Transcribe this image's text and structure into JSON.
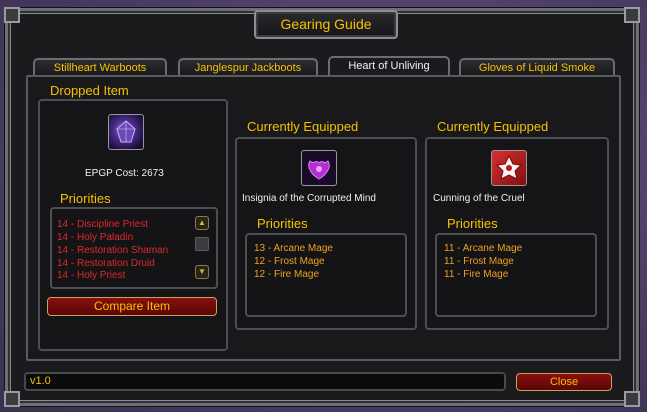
{
  "window": {
    "title": "Gearing Guide"
  },
  "tabs": [
    {
      "label": "Stillheart Warboots"
    },
    {
      "label": "Janglespur Jackboots"
    },
    {
      "label": "Heart of Unliving"
    },
    {
      "label": "Gloves of Liquid Smoke"
    }
  ],
  "dropped": {
    "heading": "Dropped Item",
    "icon": "dark-purple-gem-icon",
    "cost": "EPGP Cost: 2673",
    "priorities_heading": "Priorities",
    "priorities": [
      "14 - Discipline Priest",
      "14 - Holy Paladin",
      "14 - Restoration Shaman",
      "14 - Restoration Druid",
      "14 - Holy Priest"
    ],
    "compare_label": "Compare Item"
  },
  "equipped": [
    {
      "heading": "Currently Equipped",
      "icon": "purple-insignia-icon",
      "item_name": "Insignia of the Corrupted Mind",
      "priorities_heading": "Priorities",
      "priorities": [
        "13 - Arcane Mage",
        "12 - Frost Mage",
        "12 - Fire Mage"
      ]
    },
    {
      "heading": "Currently Equipped",
      "icon": "red-white-emblem-icon",
      "item_name": "Cunning of the Cruel",
      "priorities_heading": "Priorities",
      "priorities": [
        "11 - Arcane Mage",
        "11 - Frost Mage",
        "11 - Fire Mage"
      ]
    }
  ],
  "footer": {
    "version": "v1.0",
    "close_label": "Close"
  },
  "colors": {
    "gold": "#f6c200",
    "red_text": "#dd2a2a",
    "orange_text": "#f0a020",
    "button_red": "#7a0b0b"
  }
}
